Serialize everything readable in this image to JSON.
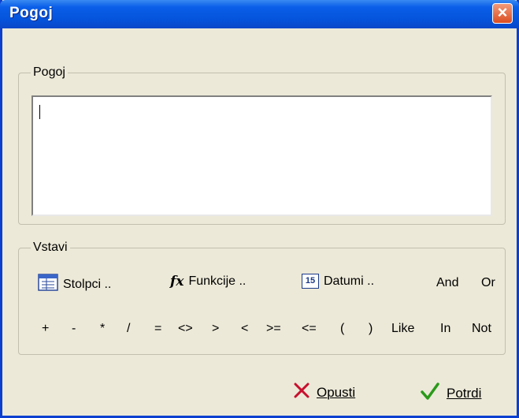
{
  "window": {
    "title": "Pogoj"
  },
  "condition": {
    "legend": "Pogoj",
    "value": ""
  },
  "insert": {
    "legend": "Vstavi",
    "columns_label": "Stolpci ..",
    "functions_label": "Funkcije ..",
    "dates_label": "Datumi ..",
    "dates_icon_text": "15",
    "and_label": "And",
    "or_label": "Or",
    "operators": [
      "+",
      "-",
      "*",
      "/",
      "=",
      "<>",
      ">",
      "<",
      ">=",
      "<=",
      "(",
      ")",
      "Like",
      "In",
      "Not"
    ]
  },
  "buttons": {
    "cancel": "Opusti",
    "confirm": "Potrdi"
  },
  "icons": {
    "columns": "table-icon",
    "functions": "fx-icon",
    "dates": "calendar-icon",
    "cancel": "x-icon",
    "confirm": "check-icon",
    "close": "close-icon"
  },
  "colors": {
    "titlebar": "#0553db",
    "dialog_bg": "#ece9d8",
    "close": "#dd4d20",
    "cancel_icon": "#c8102e",
    "confirm_icon": "#2a9a1a"
  }
}
